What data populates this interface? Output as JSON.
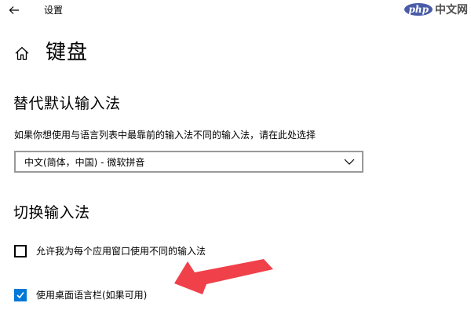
{
  "window": {
    "title": "设置"
  },
  "watermark": {
    "badge": "php",
    "text": "中文网"
  },
  "page": {
    "title": "键盘"
  },
  "override_section": {
    "title": "替代默认输入法",
    "description": "如果你想使用与语言列表中最靠前的输入法不同的输入法，请在此处选择",
    "dropdown_value": "中文(简体，中国) - 微软拼音"
  },
  "switch_section": {
    "title": "切换输入法",
    "options": [
      {
        "label": "允许我为每个应用窗口使用不同的输入法",
        "checked": false
      },
      {
        "label": "使用桌面语言栏(如果可用)",
        "checked": true
      }
    ]
  },
  "colors": {
    "accent": "#0078d7",
    "annotation_arrow": "#f0404a"
  },
  "icons": [
    "back-arrow-icon",
    "home-icon",
    "chevron-down-icon",
    "checkmark-icon"
  ]
}
